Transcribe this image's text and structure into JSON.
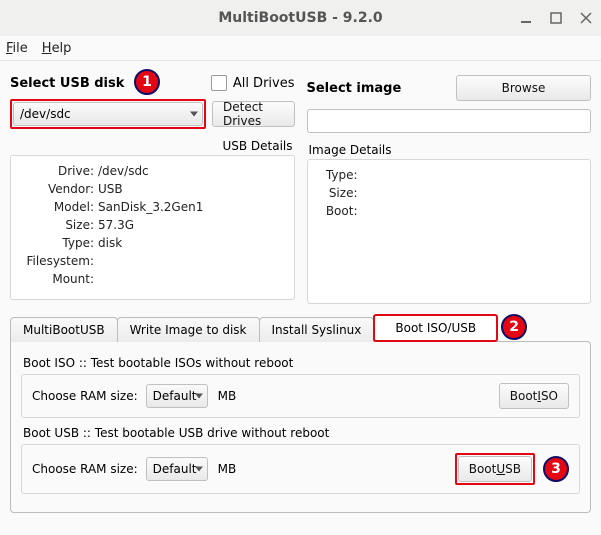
{
  "window": {
    "title": "MultiBootUSB - 9.2.0"
  },
  "menu": {
    "file": "File",
    "help": "Help"
  },
  "left": {
    "select_usb": "Select USB disk",
    "all_drives": "All Drives",
    "combo_value": "/dev/sdc",
    "detect": "Detect Drives",
    "usb_details_label": "USB Details",
    "details": {
      "drive": "/dev/sdc",
      "vendor": "USB",
      "model": "SanDisk_3.2Gen1",
      "size": "57.3G",
      "type": "disk",
      "filesystem": "",
      "mount": ""
    },
    "labels": {
      "drive": "Drive:",
      "vendor": "Vendor:",
      "model": "Model:",
      "size": "Size:",
      "type": "Type:",
      "filesystem": "Filesystem:",
      "mount": "Mount:"
    }
  },
  "right": {
    "select_image": "Select image",
    "browse": "Browse",
    "image_path": "",
    "image_details_label": "Image Details",
    "labels": {
      "type": "Type:",
      "size": "Size:",
      "boot": "Boot:"
    }
  },
  "tabs": {
    "t1": "MultiBootUSB",
    "t2": "Write Image to disk",
    "t3": "Install Syslinux",
    "t4": "Boot ISO/USB"
  },
  "bootiso": {
    "title": "Boot ISO :: Test bootable ISOs without reboot",
    "ram_label": "Choose RAM size:",
    "ram_value": "Default",
    "mb": "MB",
    "btn": "Boot ISO"
  },
  "bootusb": {
    "title": "Boot USB :: Test bootable USB drive without reboot",
    "ram_label": "Choose RAM size:",
    "ram_value": "Default",
    "mb": "MB",
    "btn": "Boot USB"
  },
  "badges": {
    "b1": "1",
    "b2": "2",
    "b3": "3"
  }
}
